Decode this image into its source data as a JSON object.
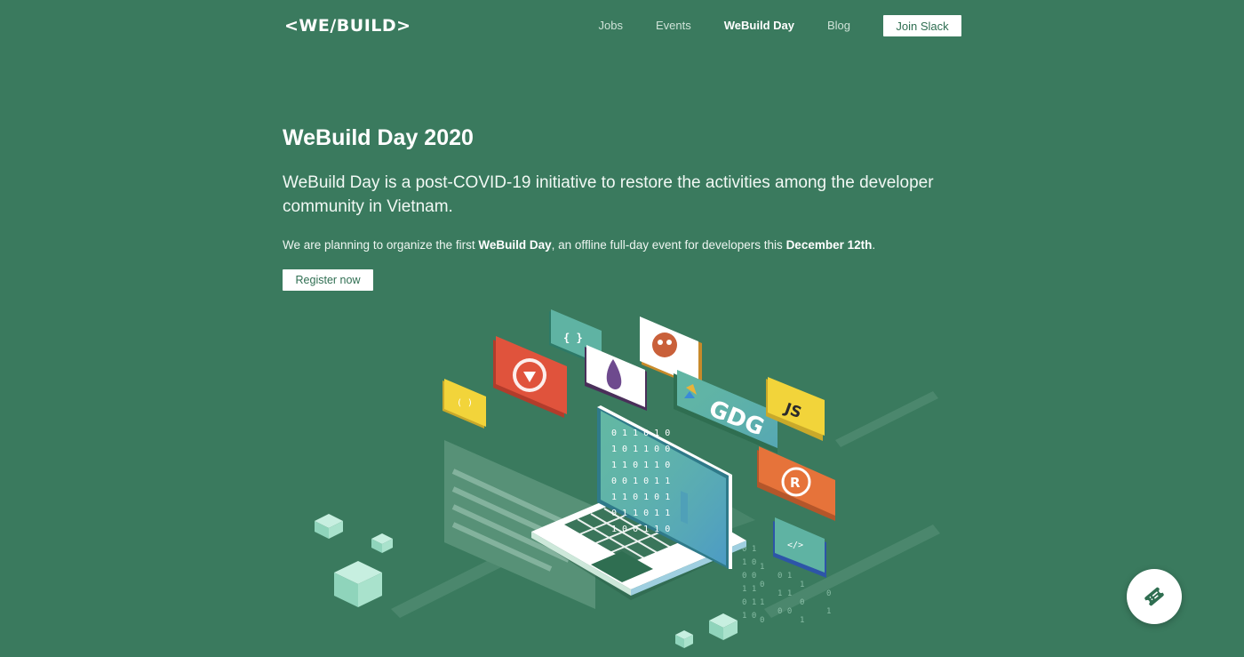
{
  "brand": {
    "logo_text": "<WE/BUILD>"
  },
  "nav": {
    "items": [
      {
        "label": "Jobs",
        "active": false
      },
      {
        "label": "Events",
        "active": false
      },
      {
        "label": "WeBuild Day",
        "active": true
      },
      {
        "label": "Blog",
        "active": false
      }
    ],
    "join_label": "Join Slack"
  },
  "hero": {
    "title": "WeBuild Day 2020",
    "lead": "WeBuild Day is a post-COVID-19 initiative to restore the activities among the developer community in Vietnam.",
    "subtext": {
      "part1": "We are planning to organize the first ",
      "bold1": "WeBuild Day",
      "part2": ", an offline full-day event for developers this ",
      "bold2": "December 12th",
      "part3": "."
    },
    "register_label": "Register now"
  },
  "illustration": {
    "tiles": {
      "braces": "{ }",
      "parens": "( )",
      "gdg": "GDG",
      "js": "JS",
      "code": "</>"
    },
    "binary_rows": [
      "0 1 1 0 1 0",
      "1 0 1 1 0 0",
      "1 1 0 1 1 0",
      "0 0 1 0 1 1",
      "1 1 0 1 0 1",
      "0 1 1 0 1 1",
      "1 0 0 1 1 0"
    ]
  },
  "colors": {
    "background": "#3a7a5e",
    "button_text": "#2f6e51",
    "red_tile": "#e0533c",
    "yellow_tile": "#f2d43a",
    "orange_tile": "#e6733a",
    "teal_tile": "#5fb3a3",
    "blue_tile": "#4f9fc4"
  },
  "fab": {
    "icon": "ticket-icon"
  }
}
